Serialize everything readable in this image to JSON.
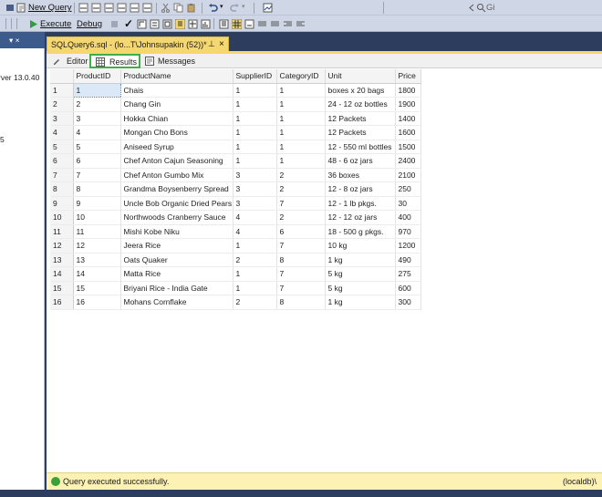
{
  "toolbar": {
    "new_query_label": "New Query",
    "execute_label": "Execute",
    "debug_label": "Debug",
    "search_hint": "Gi"
  },
  "object_explorer": {
    "header_marker": "▾ ×",
    "server_fragment": "rver 13.0.40",
    "fragment_two": "5"
  },
  "document_tab": {
    "title": "SQLQuery6.sql - (lo...T\\Johnsupakin (52))*",
    "pin_glyph": "⊥",
    "close_glyph": "×"
  },
  "result_tabs": {
    "editor": "Editor",
    "results": "Results",
    "messages": "Messages"
  },
  "grid": {
    "columns": [
      "ProductID",
      "ProductName",
      "SupplierID",
      "CategoryID",
      "Unit",
      "Price"
    ],
    "rows": [
      {
        "n": "1",
        "id": "1",
        "name": "Chais",
        "sup": "1",
        "cat": "1",
        "unit": "boxes x 20 bags",
        "price": "1800"
      },
      {
        "n": "2",
        "id": "2",
        "name": "Chang Gin",
        "sup": "1",
        "cat": "1",
        "unit": "24 - 12 oz bottles",
        "price": "1900"
      },
      {
        "n": "3",
        "id": "3",
        "name": "Hokka Chian",
        "sup": "1",
        "cat": "1",
        "unit": "12 Packets",
        "price": "1400"
      },
      {
        "n": "4",
        "id": "4",
        "name": "Mongan Cho  Bons",
        "sup": "1",
        "cat": "1",
        "unit": "12 Packets",
        "price": "1600"
      },
      {
        "n": "5",
        "id": "5",
        "name": "Aniseed Syrup",
        "sup": "1",
        "cat": "1",
        "unit": "12 - 550 ml bottles",
        "price": "1500"
      },
      {
        "n": "6",
        "id": "6",
        "name": "Chef Anton Cajun Seasoning",
        "sup": "1",
        "cat": "1",
        "unit": "48 - 6 oz jars",
        "price": "2400"
      },
      {
        "n": "7",
        "id": "7",
        "name": "Chef Anton Gumbo Mix",
        "sup": "3",
        "cat": "2",
        "unit": "36 boxes",
        "price": "2100"
      },
      {
        "n": "8",
        "id": "8",
        "name": "Grandma Boysenberry Spread",
        "sup": "3",
        "cat": "2",
        "unit": "12 - 8 oz jars",
        "price": "250"
      },
      {
        "n": "9",
        "id": "9",
        "name": "Uncle Bob Organic Dried Pears",
        "sup": "3",
        "cat": "7",
        "unit": "12 - 1 lb pkgs.",
        "price": "30"
      },
      {
        "n": "10",
        "id": "10",
        "name": "Northwoods Cranberry Sauce",
        "sup": "4",
        "cat": "2",
        "unit": "12 - 12 oz jars",
        "price": "400"
      },
      {
        "n": "11",
        "id": "11",
        "name": "Mishi Kobe Niku",
        "sup": "4",
        "cat": "6",
        "unit": "18 - 500 g pkgs.",
        "price": "970"
      },
      {
        "n": "12",
        "id": "12",
        "name": "Jeera Rice",
        "sup": "1",
        "cat": "7",
        "unit": "10 kg",
        "price": "1200"
      },
      {
        "n": "13",
        "id": "13",
        "name": "Oats Quaker",
        "sup": "2",
        "cat": "8",
        "unit": "1 kg",
        "price": "490"
      },
      {
        "n": "14",
        "id": "14",
        "name": "Matta Rice",
        "sup": "1",
        "cat": "7",
        "unit": "5 kg",
        "price": "275"
      },
      {
        "n": "15",
        "id": "15",
        "name": "Briyani Rice - India Gate",
        "sup": "1",
        "cat": "7",
        "unit": "5 kg",
        "price": "600"
      },
      {
        "n": "16",
        "id": "16",
        "name": "Mohans Cornflake",
        "sup": "2",
        "cat": "8",
        "unit": "1 kg",
        "price": "300"
      }
    ]
  },
  "status": {
    "message": "Query executed successfully.",
    "server": "(localdb)\\"
  },
  "colors": {
    "doc_tab": "#f5d772",
    "status_bar": "#fdf1b3",
    "results_highlight": "#3fae47",
    "editor_frame": "#2d3d5e"
  }
}
